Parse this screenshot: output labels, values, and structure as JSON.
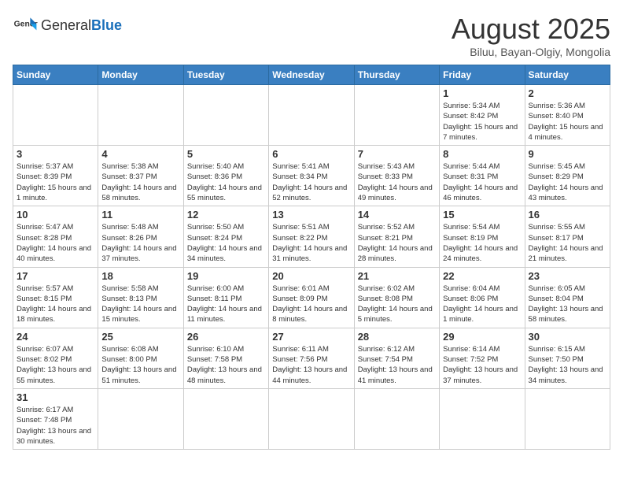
{
  "header": {
    "logo_general": "General",
    "logo_blue": "Blue",
    "month_title": "August 2025",
    "location": "Biluu, Bayan-Olgiy, Mongolia"
  },
  "days_of_week": [
    "Sunday",
    "Monday",
    "Tuesday",
    "Wednesday",
    "Thursday",
    "Friday",
    "Saturday"
  ],
  "weeks": [
    [
      {
        "day": "",
        "info": ""
      },
      {
        "day": "",
        "info": ""
      },
      {
        "day": "",
        "info": ""
      },
      {
        "day": "",
        "info": ""
      },
      {
        "day": "",
        "info": ""
      },
      {
        "day": "1",
        "info": "Sunrise: 5:34 AM\nSunset: 8:42 PM\nDaylight: 15 hours and 7 minutes."
      },
      {
        "day": "2",
        "info": "Sunrise: 5:36 AM\nSunset: 8:40 PM\nDaylight: 15 hours and 4 minutes."
      }
    ],
    [
      {
        "day": "3",
        "info": "Sunrise: 5:37 AM\nSunset: 8:39 PM\nDaylight: 15 hours and 1 minute."
      },
      {
        "day": "4",
        "info": "Sunrise: 5:38 AM\nSunset: 8:37 PM\nDaylight: 14 hours and 58 minutes."
      },
      {
        "day": "5",
        "info": "Sunrise: 5:40 AM\nSunset: 8:36 PM\nDaylight: 14 hours and 55 minutes."
      },
      {
        "day": "6",
        "info": "Sunrise: 5:41 AM\nSunset: 8:34 PM\nDaylight: 14 hours and 52 minutes."
      },
      {
        "day": "7",
        "info": "Sunrise: 5:43 AM\nSunset: 8:33 PM\nDaylight: 14 hours and 49 minutes."
      },
      {
        "day": "8",
        "info": "Sunrise: 5:44 AM\nSunset: 8:31 PM\nDaylight: 14 hours and 46 minutes."
      },
      {
        "day": "9",
        "info": "Sunrise: 5:45 AM\nSunset: 8:29 PM\nDaylight: 14 hours and 43 minutes."
      }
    ],
    [
      {
        "day": "10",
        "info": "Sunrise: 5:47 AM\nSunset: 8:28 PM\nDaylight: 14 hours and 40 minutes."
      },
      {
        "day": "11",
        "info": "Sunrise: 5:48 AM\nSunset: 8:26 PM\nDaylight: 14 hours and 37 minutes."
      },
      {
        "day": "12",
        "info": "Sunrise: 5:50 AM\nSunset: 8:24 PM\nDaylight: 14 hours and 34 minutes."
      },
      {
        "day": "13",
        "info": "Sunrise: 5:51 AM\nSunset: 8:22 PM\nDaylight: 14 hours and 31 minutes."
      },
      {
        "day": "14",
        "info": "Sunrise: 5:52 AM\nSunset: 8:21 PM\nDaylight: 14 hours and 28 minutes."
      },
      {
        "day": "15",
        "info": "Sunrise: 5:54 AM\nSunset: 8:19 PM\nDaylight: 14 hours and 24 minutes."
      },
      {
        "day": "16",
        "info": "Sunrise: 5:55 AM\nSunset: 8:17 PM\nDaylight: 14 hours and 21 minutes."
      }
    ],
    [
      {
        "day": "17",
        "info": "Sunrise: 5:57 AM\nSunset: 8:15 PM\nDaylight: 14 hours and 18 minutes."
      },
      {
        "day": "18",
        "info": "Sunrise: 5:58 AM\nSunset: 8:13 PM\nDaylight: 14 hours and 15 minutes."
      },
      {
        "day": "19",
        "info": "Sunrise: 6:00 AM\nSunset: 8:11 PM\nDaylight: 14 hours and 11 minutes."
      },
      {
        "day": "20",
        "info": "Sunrise: 6:01 AM\nSunset: 8:09 PM\nDaylight: 14 hours and 8 minutes."
      },
      {
        "day": "21",
        "info": "Sunrise: 6:02 AM\nSunset: 8:08 PM\nDaylight: 14 hours and 5 minutes."
      },
      {
        "day": "22",
        "info": "Sunrise: 6:04 AM\nSunset: 8:06 PM\nDaylight: 14 hours and 1 minute."
      },
      {
        "day": "23",
        "info": "Sunrise: 6:05 AM\nSunset: 8:04 PM\nDaylight: 13 hours and 58 minutes."
      }
    ],
    [
      {
        "day": "24",
        "info": "Sunrise: 6:07 AM\nSunset: 8:02 PM\nDaylight: 13 hours and 55 minutes."
      },
      {
        "day": "25",
        "info": "Sunrise: 6:08 AM\nSunset: 8:00 PM\nDaylight: 13 hours and 51 minutes."
      },
      {
        "day": "26",
        "info": "Sunrise: 6:10 AM\nSunset: 7:58 PM\nDaylight: 13 hours and 48 minutes."
      },
      {
        "day": "27",
        "info": "Sunrise: 6:11 AM\nSunset: 7:56 PM\nDaylight: 13 hours and 44 minutes."
      },
      {
        "day": "28",
        "info": "Sunrise: 6:12 AM\nSunset: 7:54 PM\nDaylight: 13 hours and 41 minutes."
      },
      {
        "day": "29",
        "info": "Sunrise: 6:14 AM\nSunset: 7:52 PM\nDaylight: 13 hours and 37 minutes."
      },
      {
        "day": "30",
        "info": "Sunrise: 6:15 AM\nSunset: 7:50 PM\nDaylight: 13 hours and 34 minutes."
      }
    ],
    [
      {
        "day": "31",
        "info": "Sunrise: 6:17 AM\nSunset: 7:48 PM\nDaylight: 13 hours and 30 minutes."
      },
      {
        "day": "",
        "info": ""
      },
      {
        "day": "",
        "info": ""
      },
      {
        "day": "",
        "info": ""
      },
      {
        "day": "",
        "info": ""
      },
      {
        "day": "",
        "info": ""
      },
      {
        "day": "",
        "info": ""
      }
    ]
  ]
}
